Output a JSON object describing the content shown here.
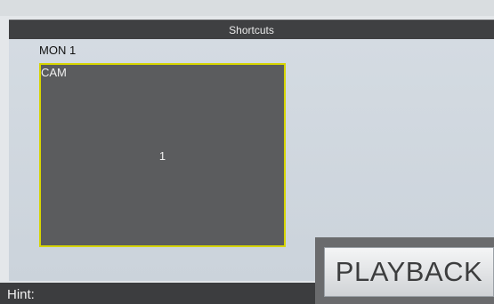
{
  "window": {
    "title": "Shortcuts"
  },
  "monitor": {
    "label": "MON 1"
  },
  "camera_tile": {
    "label": "CAM",
    "number": "1"
  },
  "buttons": {
    "playback_label": "PLAYBACK"
  },
  "hint": {
    "label": "Hint:"
  },
  "colors": {
    "title_bar": "#3f4042",
    "tile_border": "#d6d400",
    "tile_fill": "#5b5c5e",
    "hint_bar": "#3c3d3f"
  }
}
